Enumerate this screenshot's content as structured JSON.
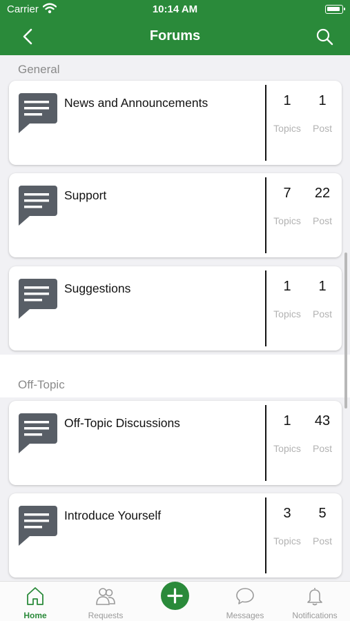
{
  "status_bar": {
    "carrier": "Carrier",
    "time": "10:14 AM"
  },
  "nav": {
    "title": "Forums"
  },
  "sections": [
    {
      "title": "General",
      "forums": [
        {
          "name": "News and Announcements",
          "topics": "1",
          "posts": "1"
        },
        {
          "name": "Support",
          "topics": "7",
          "posts": "22"
        },
        {
          "name": "Suggestions",
          "topics": "1",
          "posts": "1"
        }
      ]
    },
    {
      "title": "Off-Topic",
      "forums": [
        {
          "name": "Off-Topic Discussions",
          "topics": "1",
          "posts": "43"
        },
        {
          "name": "Introduce Yourself",
          "topics": "3",
          "posts": "5"
        }
      ]
    }
  ],
  "labels": {
    "topics": "Topics",
    "posts": "Post"
  },
  "tabbar": {
    "home": "Home",
    "requests": "Requests",
    "messages": "Messages",
    "notifications": "Notifications"
  },
  "colors": {
    "brand": "#2a8a3a",
    "forum_icon": "#585e66"
  },
  "icons": {
    "back": "chevron-left-icon",
    "search": "search-icon",
    "forum": "chat-bubble-icon",
    "home": "home-icon",
    "requests": "people-icon",
    "new_post": "plus-icon",
    "messages": "speech-bubble-icon",
    "notifications": "bell-icon"
  }
}
